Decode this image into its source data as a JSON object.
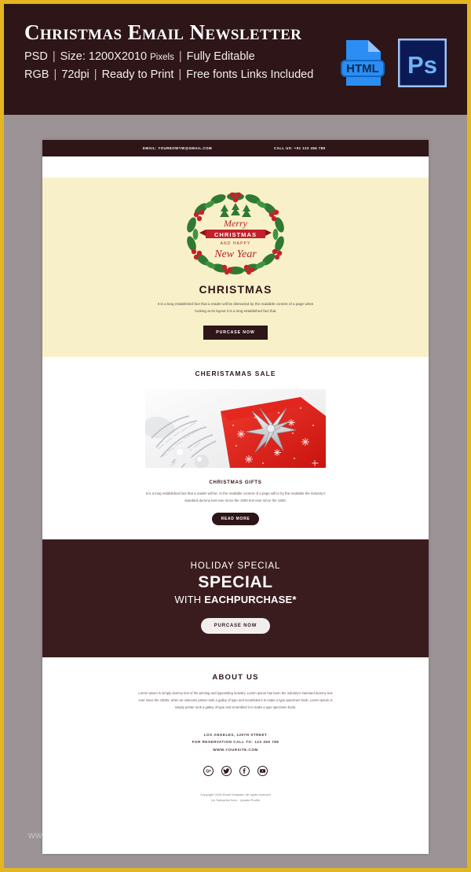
{
  "promo": {
    "title": "Christmas Email Newsletter",
    "line1_parts": [
      "PSD",
      "Size: 1200X2010",
      "Pixels",
      "Fully Editable"
    ],
    "line2_parts": [
      "RGB",
      "72dpi",
      "Ready to Print",
      "Free fonts Links Included"
    ],
    "badges": [
      {
        "name": "html-file-icon",
        "label": "HTML"
      },
      {
        "name": "photoshop-icon",
        "label": "Ps"
      }
    ],
    "colors": {
      "background": "#2e1517",
      "border": "#e3b520",
      "text": "#ffffff"
    }
  },
  "email": {
    "topbar": {
      "email_label": "EMAIL:  YOUREOWYW@GMAIL.COM",
      "phone_label": "CALL US:  +91 123 456 789",
      "background": "#2e1517"
    },
    "hero": {
      "wreath_alt": "Merry Christmas and Happy New Year wreath",
      "wreath_line1": "Merry",
      "wreath_line2": "CHRISTMAS",
      "wreath_line3": "AND HAPPY",
      "wreath_line4": "New Year",
      "heading": "CHRISTMAS",
      "body": "It is a long established fact that a reader will be distracted by the readable content of a page when looking at its layout it is a long established fact that",
      "cta": "PURCASE NOW",
      "background": "#f8f0c8"
    },
    "sale": {
      "heading": "CHERISTAMAS SALE",
      "photo_alt": "Red gift box with silver bow and tinsel",
      "subheading": "CHRISTMAS GIFTS",
      "body": "It is a long established fact that a reader will be. In the readable content of a page will to by the readable the industry's standard dummy text ever since the 1500 text ever since the 1500.",
      "cta": "READ MORE"
    },
    "special": {
      "kicker": "HOLIDAY SPECIAL",
      "headline": "SPECIAL",
      "sub_prefix": "WITH ",
      "sub_strong": "EACHPURCHASE*",
      "cta": "PURCASE NOW",
      "background": "#3b1c1e"
    },
    "about": {
      "heading": "ABOUT US",
      "body": "Lorem Ipsum is simply dummy text of the printing and typesetting industry. Lorem Ipsum has been the industry's standard dummy text ever since the 1500s, when an unknown printer took a galley of type and scrambled it to make a type specimen book. Lorem Ipsum is simply printer took a galley of type and scrambled it to make a type specimen book."
    },
    "footer": {
      "address_lines": [
        "LOS ANGELES, 1297H STREET",
        "FOR RESERVATION CALL TO: 123 456 789",
        "WWW.YOURSITE.COM"
      ],
      "socials": [
        {
          "name": "google-plus-icon",
          "label": "G+"
        },
        {
          "name": "twitter-icon",
          "label": "Twitter"
        },
        {
          "name": "facebook-icon",
          "label": "Facebook"
        },
        {
          "name": "youtube-icon",
          "label": "YouTube"
        }
      ],
      "copyright_line1": "Copyright 2015 Email Template. All rights reserved",
      "copyright_line2": "Un Subscribe here - Update Profile"
    }
  },
  "watermark": "www.template.net/christmas-newsletter"
}
